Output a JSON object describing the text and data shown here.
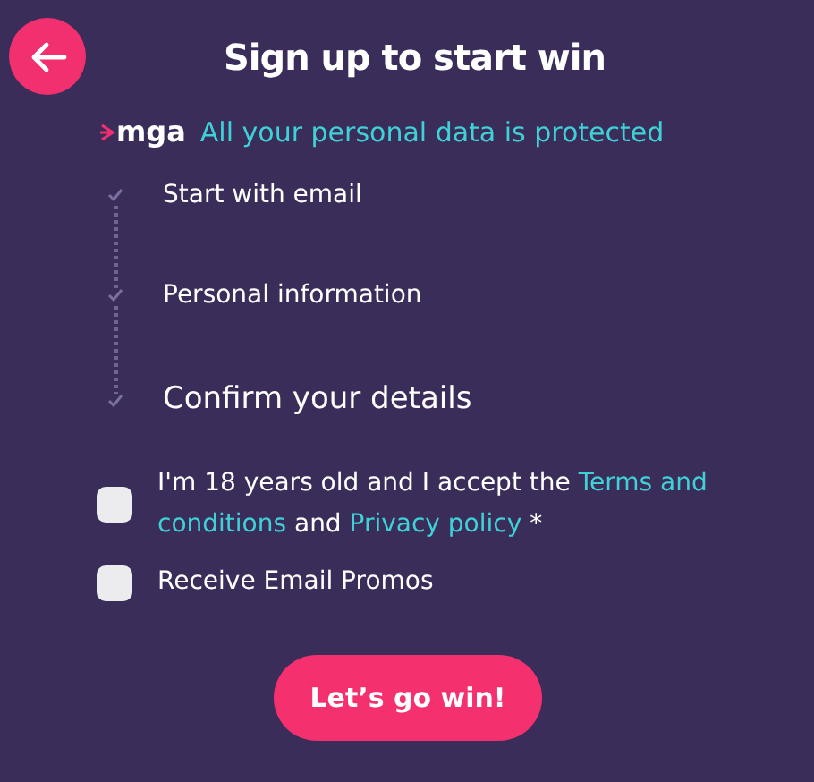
{
  "header": {
    "title": "Sign up to start win"
  },
  "security": {
    "brand": "mga",
    "message": "All your personal data is protected"
  },
  "steps": [
    {
      "label": "Start with email",
      "kind": "small"
    },
    {
      "label": "Personal information",
      "kind": "small"
    },
    {
      "label": "Confirm your details",
      "kind": "large"
    }
  ],
  "checkboxes": [
    {
      "checked": false,
      "parts": [
        {
          "kind": "plain",
          "text": "I'm 18 years old and I accept the"
        },
        {
          "kind": "link",
          "text": "Terms and"
        },
        {
          "kind": "link",
          "text": "conditions"
        },
        {
          "kind": "plain",
          "text": "and"
        },
        {
          "kind": "link",
          "text": "Privacy policy"
        },
        {
          "kind": "plain",
          "text": "*"
        }
      ]
    },
    {
      "checked": false,
      "parts": [
        {
          "kind": "plain",
          "text": "Receive Email Promos"
        }
      ]
    }
  ],
  "submit": {
    "label": "Let’s go win!"
  }
}
